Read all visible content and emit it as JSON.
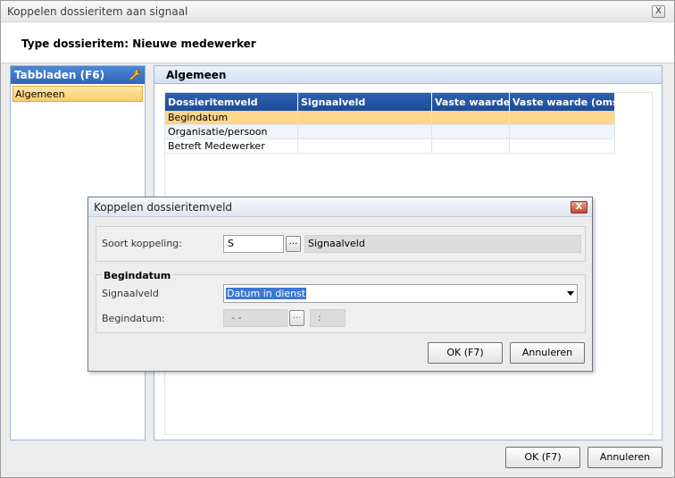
{
  "window": {
    "title": "Koppelen dossieritem aan signaal",
    "close_glyph": "X",
    "header": "Type dossieritem: Nieuwe medewerker"
  },
  "left_panel": {
    "title": "Tabbladen (F6)",
    "icon": "wrench-icon",
    "items": [
      {
        "label": "Algemeen"
      }
    ]
  },
  "right_panel": {
    "title": "Algemeen",
    "columns": [
      "Dossieritemveld",
      "Signaalveld",
      "Vaste waarde",
      "Vaste waarde (omsc"
    ],
    "rows": [
      {
        "cells": [
          "Begindatum",
          "",
          "",
          ""
        ]
      },
      {
        "cells": [
          "Organisatie/persoon",
          "",
          "",
          ""
        ]
      },
      {
        "cells": [
          "Betreft Medewerker",
          "",
          "",
          ""
        ]
      }
    ]
  },
  "main_buttons": {
    "ok": "OK (F7)",
    "cancel": "Annuleren"
  },
  "dialog": {
    "title": "Koppelen dossieritemveld",
    "close_glyph": "X",
    "soort_label": "Soort koppeling:",
    "soort_value": "S",
    "browse_glyph": "...",
    "soort_description": "Signaalveld",
    "group_title": "Begindatum",
    "signaalveld_label": "Signaalveld",
    "signaalveld_value": "Datum in dienst",
    "begindatum_label": "Begindatum:",
    "date_placeholder": "-  -",
    "time_placeholder": ":",
    "ok": "OK (F7)",
    "cancel": "Annuleren"
  },
  "colors": {
    "header_blue": "#2c61b1",
    "selected_row": "#fdd58c",
    "selection_highlight": "#3a78d2"
  }
}
